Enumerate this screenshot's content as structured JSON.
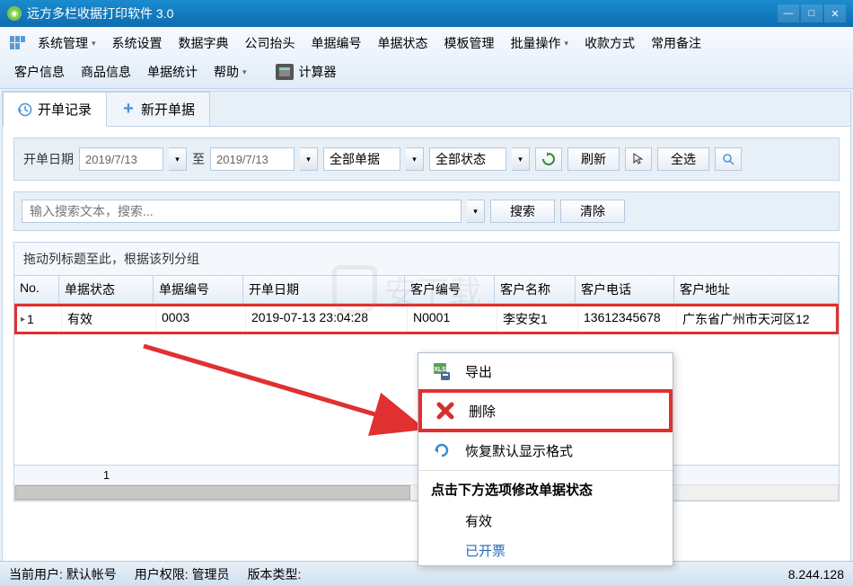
{
  "window": {
    "title": "远方多栏收据打印软件 3.0"
  },
  "menus": {
    "row1": [
      "系统管理",
      "系统设置",
      "数据字典",
      "公司抬头",
      "单据编号",
      "单据状态",
      "模板管理",
      "批量操作",
      "收款方式",
      "常用备注"
    ],
    "row2": [
      "客户信息",
      "商品信息",
      "单据统计",
      "帮助"
    ],
    "calculator": "计算器"
  },
  "tabs": {
    "records": "开单记录",
    "new": "新开单据"
  },
  "filter": {
    "date_label": "开单日期",
    "date_from": "2019/7/13",
    "date_to_label": "至",
    "date_to": "2019/7/13",
    "doc_type": "全部单据",
    "status": "全部状态",
    "refresh": "刷新",
    "select_all": "全选"
  },
  "search": {
    "placeholder": "输入搜索文本，搜索...",
    "btn_search": "搜索",
    "btn_clear": "清除"
  },
  "grid": {
    "group_hint": "拖动列标题至此，根据该列分组",
    "headers": {
      "no": "No.",
      "status": "单据状态",
      "number": "单据编号",
      "date": "开单日期",
      "cust_no": "客户编号",
      "cust_name": "客户名称",
      "cust_phone": "客户电话",
      "cust_addr": "客户地址"
    },
    "rows": [
      {
        "no": "1",
        "status": "有效",
        "number": "0003",
        "date": "2019-07-13 23:04:28",
        "cust_no": "N0001",
        "cust_name": "李安安1",
        "cust_phone": "13612345678",
        "cust_addr": "广东省广州市天河区12"
      }
    ],
    "footer_count": "1"
  },
  "context_menu": {
    "export": "导出",
    "delete": "删除",
    "restore": "恢复默认显示格式",
    "status_header": "点击下方选项修改单据状态",
    "status_valid": "有效",
    "status_invoiced": "已开票"
  },
  "statusbar": {
    "user_label": "当前用户:",
    "user_value": "默认帐号",
    "role_label": "用户权限:",
    "role_value": "管理员",
    "version_label": "版本类型:",
    "ip": "8.244.128"
  },
  "watermark": "安下载"
}
